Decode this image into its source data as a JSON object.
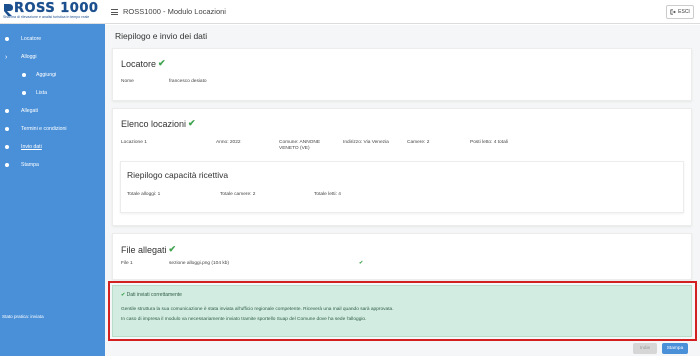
{
  "brand": {
    "name": "ROSS 1000",
    "subtitle": "Sistema di rilevazione e analisi turistica in tempo reale"
  },
  "sidebar": {
    "items": [
      {
        "label": "Locatore",
        "icon": "dot-icon"
      },
      {
        "label": "Alloggi",
        "icon": "chevron-right-icon"
      },
      {
        "label": "Aggiungi",
        "icon": "dot-icon"
      },
      {
        "label": "Lista",
        "icon": "dot-icon"
      },
      {
        "label": "Allegati",
        "icon": "dot-icon"
      },
      {
        "label": "Termini e condizioni",
        "icon": "dot-icon"
      },
      {
        "label": "Invio dati",
        "icon": "dot-icon"
      },
      {
        "label": "Stampa",
        "icon": "dot-icon"
      }
    ],
    "footer": "Stato pratica: inviata"
  },
  "header": {
    "title": "ROSS1000 - Modulo Locazioni",
    "exit_label": "ESCI"
  },
  "main": {
    "title": "Riepilogo e invio dei dati",
    "locatore": {
      "title": "Locatore",
      "name_label": "Nome",
      "name_value": "francesco desiato"
    },
    "locazioni": {
      "title": "Elenco locazioni",
      "row": {
        "locazione": "Locazione 1",
        "anno": "Anno: 2022",
        "comune": "Comune: ANNONE VENETO (VE)",
        "indirizzo": "Indirizzo: Via Venezia",
        "camere": "Camere: 2",
        "posti": "Posti letto: 4 totali"
      },
      "capacita": {
        "title": "Riepilogo capacità ricettiva",
        "alloggi": "Totale alloggi: 1",
        "camere": "Totale camere: 2",
        "letti": "Totale letti: 4"
      }
    },
    "allegati": {
      "title": "File allegati",
      "file_label": "File 1",
      "file_value": "sezione alloggi.png (104 kb)"
    },
    "success": {
      "heading": "Dati inviati correttamente",
      "line1": "Gentile struttura la sua comunicazione è stata inviata all'ufficio regionale competente. Riceverà una mail quando sarà approvata.",
      "line2": "In caso di impresa il modulo va necessariamente inviato tramite sportello Suap del Comune dove ha sede l'alloggio."
    }
  },
  "footer_buttons": {
    "back": "Indie",
    "print": "Stampa"
  },
  "colors": {
    "accent": "#4a90d9",
    "success_bg": "#d3ece1",
    "check": "#3fa34d",
    "highlight": "#d21f1f"
  }
}
